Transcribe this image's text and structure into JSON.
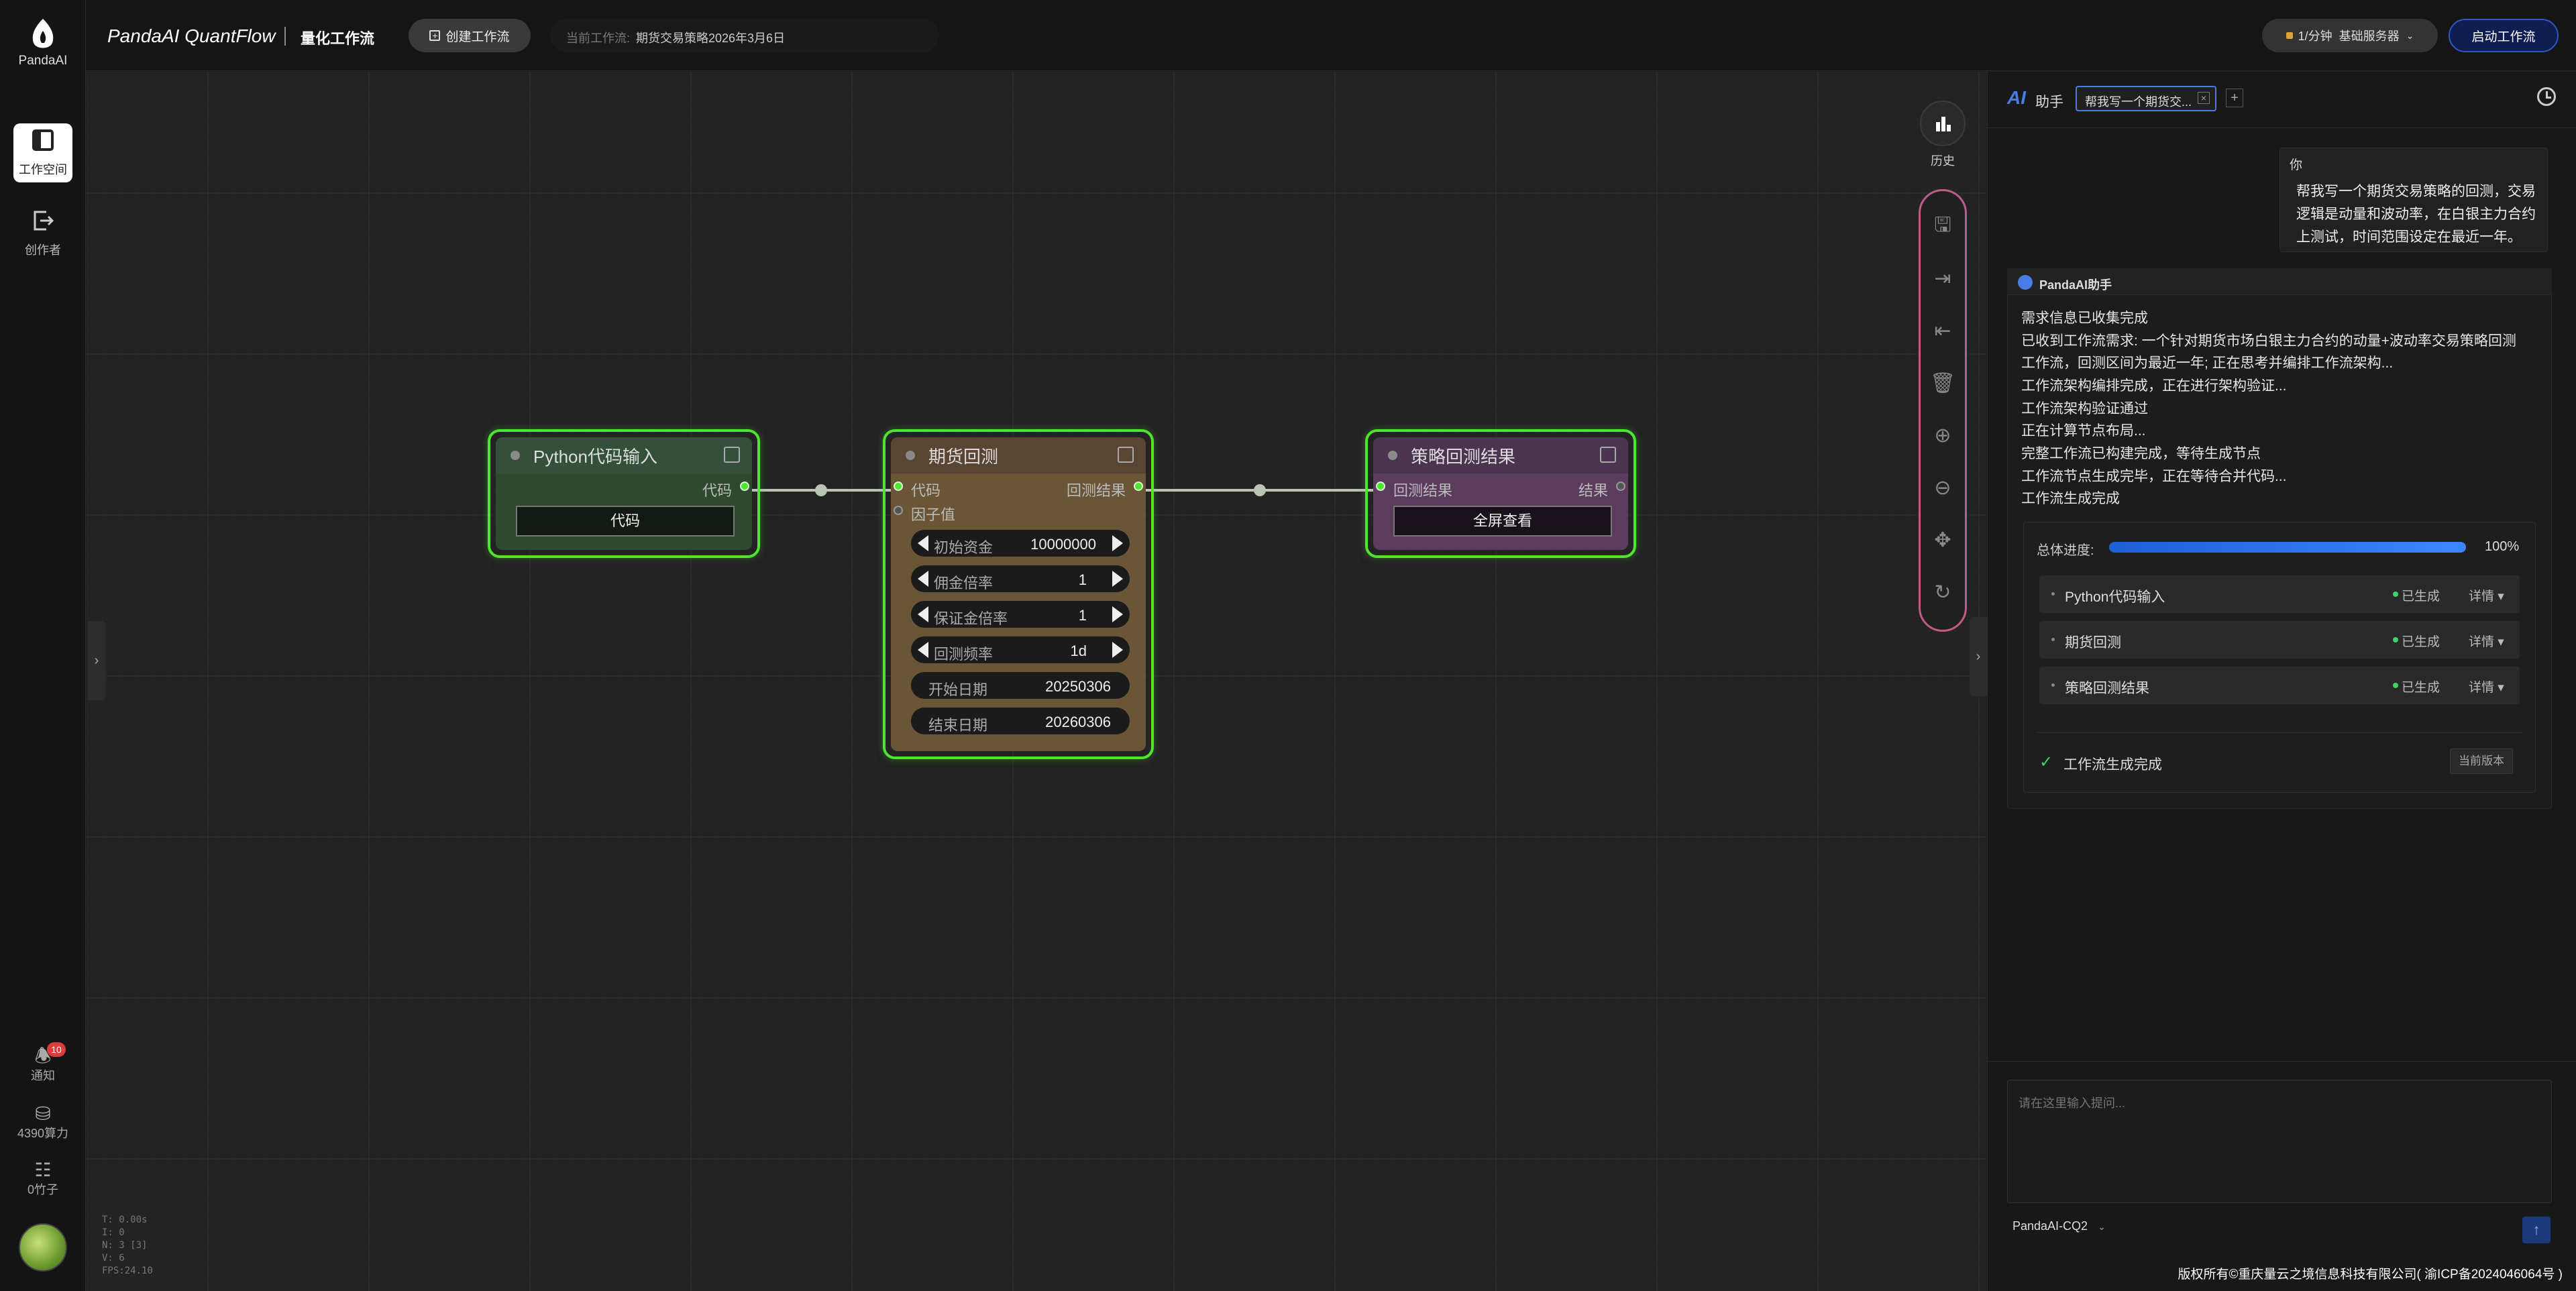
{
  "sidebar": {
    "brand": "PandaAI",
    "nav": [
      {
        "label": "工作空间",
        "icon": "workspace-icon"
      },
      {
        "label": "创作者",
        "icon": "creator-icon"
      }
    ],
    "notify_label": "通知",
    "notify_badge": "10",
    "compute_label": "4390算力",
    "bamboo_label": "0竹子"
  },
  "topbar": {
    "title": "PandaAI QuantFlow",
    "subtitle": "量化工作流",
    "create_button": "创建工作流",
    "current_label": "当前工作流:",
    "current_value": "期货交易策略2026年3月6日",
    "server_select": "1/分钟  基础服务器",
    "start_button": "启动工作流"
  },
  "canvas": {
    "history_label": "历史",
    "stats": [
      "T: 0.00s",
      "I: 0",
      "N: 3 [3]",
      "V: 6",
      "FPS:24.10"
    ],
    "nodes": {
      "python": {
        "title": "Python代码输入",
        "out_slot": "代码",
        "button": "代码"
      },
      "futures": {
        "title": "期货回测",
        "in_code": "代码",
        "in_factor": "因子值",
        "out_slot": "回测结果",
        "widgets": [
          {
            "label": "初始资金",
            "value": "10000000"
          },
          {
            "label": "佣金倍率",
            "value": "1"
          },
          {
            "label": "保证金倍率",
            "value": "1"
          },
          {
            "label": "回测频率",
            "value": "1d"
          },
          {
            "label": "开始日期",
            "value": "20250306"
          },
          {
            "label": "结束日期",
            "value": "20260306"
          }
        ]
      },
      "result": {
        "title": "策略回测结果",
        "in_slot": "回测结果",
        "out_slot": "结果",
        "button": "全屏查看"
      }
    }
  },
  "ai": {
    "logo": "AI",
    "title": "助手",
    "tab": "帮我写一个期货交...",
    "user_label": "你",
    "user_message": [
      "帮我写一个期货交易策略的回测，交易",
      "逻辑是动量和波动率，在白银主力合约",
      "上测试，时间范围设定在最近一年。"
    ],
    "assistant_label": "PandaAI助手",
    "assistant_lines": [
      "需求信息已收集完成",
      "已收到工作流需求: 一个针对期货市场白银主力合约的动量+波动率交易策略回测",
      "工作流，回测区间为最近一年; 正在思考并编排工作流架构...",
      "工作流架构编排完成，正在进行架构验证...",
      "工作流架构验证通过",
      "正在计算节点布局...",
      "完整工作流已构建完成，等待生成节点",
      "工作流节点生成完毕，正在等待合并代码...",
      "工作流生成完成"
    ],
    "progress_label": "总体进度:",
    "progress_value": 1.0,
    "progress_text": "100%",
    "steps": [
      {
        "name": "Python代码输入",
        "status": "已生成",
        "detail": "详情"
      },
      {
        "name": "期货回测",
        "status": "已生成",
        "detail": "详情"
      },
      {
        "name": "策略回测结果",
        "status": "已生成",
        "detail": "详情"
      }
    ],
    "done_label": "工作流生成完成",
    "version_button": "当前版本",
    "input_placeholder": "请在这里输入提问...",
    "model": "PandaAI-CQ2"
  },
  "footer": {
    "copyright": "版权所有©重庆量云之境信息科技有限公司( 渝ICP备2024046064号 )"
  },
  "colors": {
    "accent": "#2f6fe0",
    "node_border": "#4ee52e",
    "python_node": "#2e4a2e",
    "futures_node": "#6a5637",
    "result_node": "#5b3c5e"
  }
}
